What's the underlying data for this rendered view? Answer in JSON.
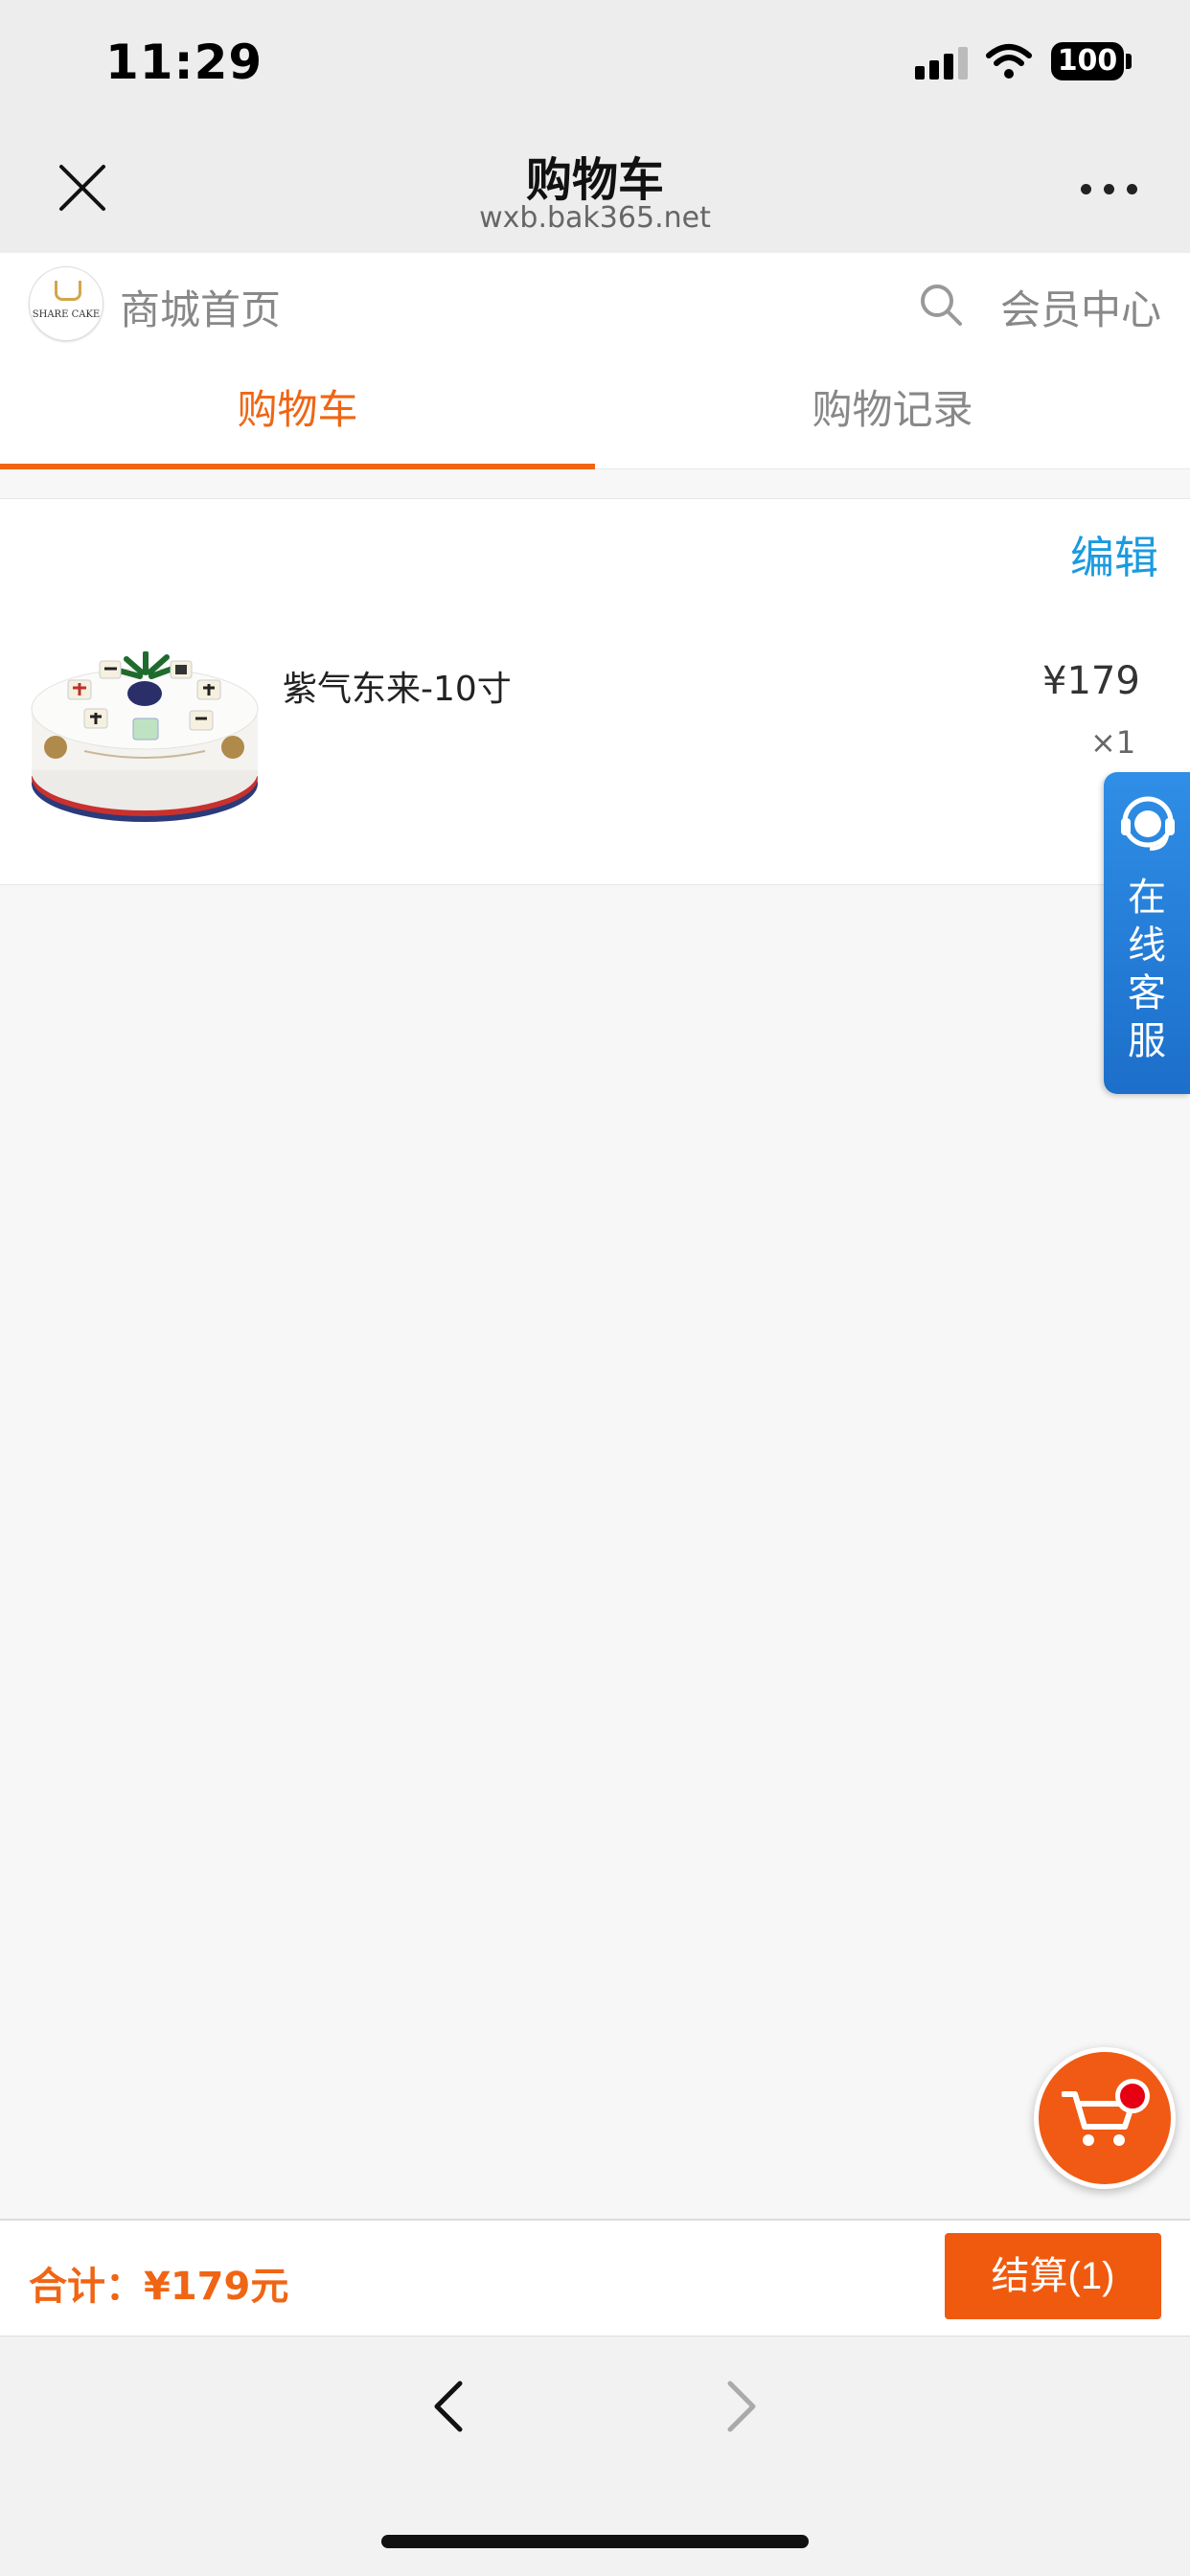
{
  "status_bar": {
    "time": "11:29",
    "battery": "100"
  },
  "nav": {
    "title": "购物车",
    "url": "wxb.bak365.net"
  },
  "shop_header": {
    "logo_text": "SHARE CAKE",
    "home_label": "商城首页",
    "member_label": "会员中心"
  },
  "tabs": [
    {
      "label": "购物车",
      "active": true
    },
    {
      "label": "购物记录",
      "active": false
    }
  ],
  "cart": {
    "edit_label": "编辑",
    "items": [
      {
        "name": "紫气东来-10寸",
        "price": "¥179",
        "quantity": "×1"
      }
    ]
  },
  "service": {
    "label": "在线客服"
  },
  "checkout": {
    "total_text": "合计：¥179元",
    "button_label": "结算(1)"
  },
  "colors": {
    "accent": "#f06514",
    "link": "#1a9ae0",
    "service": "#1c6fca",
    "badge": "#e60012"
  }
}
